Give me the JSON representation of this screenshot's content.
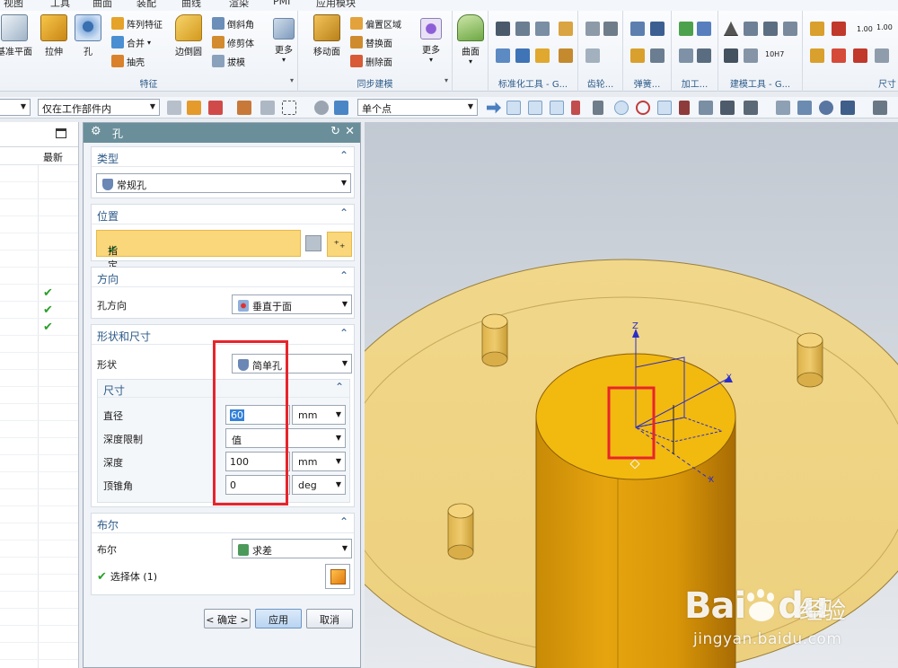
{
  "menu": [
    "视图",
    "工具",
    "曲面",
    "装配",
    "曲线",
    "渲染",
    "PMI",
    "应用模块"
  ],
  "ribbon": {
    "feature_group": {
      "label": "特征",
      "datum_plane": "基准平面",
      "extrude": "拉伸",
      "hole": "孔",
      "pattern": "阵列特征",
      "unite": "合并",
      "shell": "抽壳",
      "edge_blend": "边倒圆",
      "chamfer": "倒斜角",
      "trim_body": "修剪体",
      "draft": "拔模",
      "more": "更多"
    },
    "sync_group": {
      "label": "同步建模",
      "move_face": "移动面",
      "offset_region": "偏置区域",
      "replace_face": "替换面",
      "delete_face": "删除面",
      "more": "更多"
    },
    "surface_group": {
      "surface": "曲面"
    },
    "other_groups": [
      "标准化工具 - G...",
      "齿轮...",
      "弹簧...",
      "加工...",
      "建模工具 - G...",
      "尺寸"
    ],
    "dim_labels": [
      "1.00",
      "1.00"
    ],
    "fit_label": "10H7"
  },
  "selection_bar": {
    "filter_value": "",
    "scope_value": "仅在工作部件内",
    "snap_value": "单个点"
  },
  "navigator": {
    "col_header": "最新",
    "checked_rows": [
      7,
      8,
      9
    ]
  },
  "dialog": {
    "title": "孔",
    "type": {
      "header": "类型",
      "value": "常规孔"
    },
    "position": {
      "header": "位置",
      "specify_point": "指定点 (1)"
    },
    "direction": {
      "header": "方向",
      "label": "孔方向",
      "value": "垂直于面"
    },
    "shape": {
      "header": "形状和尺寸",
      "shape_label": "形状",
      "shape_value": "简单孔",
      "dims_header": "尺寸",
      "diameter_label": "直径",
      "diameter_value": "60",
      "diameter_unit": "mm",
      "depth_limit_label": "深度限制",
      "depth_limit_value": "值",
      "depth_label": "深度",
      "depth_value": "100",
      "depth_unit": "mm",
      "tip_angle_label": "顶锥角",
      "tip_angle_value": "0",
      "tip_angle_unit": "deg"
    },
    "boolean": {
      "header": "布尔",
      "label": "布尔",
      "value": "求差",
      "select_body": "选择体 (1)"
    },
    "ok": "< 确定 >",
    "apply": "应用",
    "cancel": "取消"
  },
  "viewport": {
    "axis_z": "Z",
    "axis_y": "Y",
    "axis_x": "X",
    "watermark_main": "Bai",
    "watermark_du": "du",
    "watermark_cn": "经验",
    "watermark_url": "jingyan.baidu.com"
  },
  "colors": {
    "accent": "#2d5a88",
    "dialog_title": "#6a8f9a",
    "highlight": "#f9d77a",
    "annotation_red": "#e8242b",
    "part_gold": "#e8b40c"
  }
}
